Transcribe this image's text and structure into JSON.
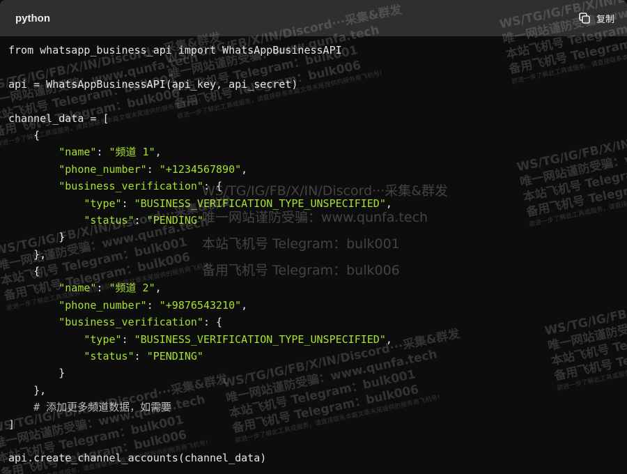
{
  "header": {
    "language": "python",
    "copy_label": "复制"
  },
  "code_lines": [
    [
      {
        "t": "from whatsapp_business_api import WhatsAppBusinessAPI",
        "c": "k"
      }
    ],
    [],
    [
      {
        "t": "api = WhatsAppBusinessAPI(api_key, api_secret)",
        "c": "k"
      }
    ],
    [],
    [
      {
        "t": "channel_data = [",
        "c": "k"
      }
    ],
    [
      {
        "t": "    {",
        "c": "k"
      }
    ],
    [
      {
        "t": "        ",
        "c": "k"
      },
      {
        "t": "\"name\"",
        "c": "s"
      },
      {
        "t": ": ",
        "c": "k"
      },
      {
        "t": "\"频道 1\"",
        "c": "s"
      },
      {
        "t": ",",
        "c": "k"
      }
    ],
    [
      {
        "t": "        ",
        "c": "k"
      },
      {
        "t": "\"phone_number\"",
        "c": "s"
      },
      {
        "t": ": ",
        "c": "k"
      },
      {
        "t": "\"+1234567890\"",
        "c": "s"
      },
      {
        "t": ",",
        "c": "k"
      }
    ],
    [
      {
        "t": "        ",
        "c": "k"
      },
      {
        "t": "\"business_verification\"",
        "c": "s"
      },
      {
        "t": ": {",
        "c": "k"
      }
    ],
    [
      {
        "t": "            ",
        "c": "k"
      },
      {
        "t": "\"type\"",
        "c": "s"
      },
      {
        "t": ": ",
        "c": "k"
      },
      {
        "t": "\"BUSINESS_VERIFICATION_TYPE_UNSPECIFIED\"",
        "c": "s"
      },
      {
        "t": ",",
        "c": "k"
      }
    ],
    [
      {
        "t": "            ",
        "c": "k"
      },
      {
        "t": "\"status\"",
        "c": "s"
      },
      {
        "t": ": ",
        "c": "k"
      },
      {
        "t": "\"PENDING\"",
        "c": "s"
      }
    ],
    [
      {
        "t": "        }",
        "c": "k"
      }
    ],
    [
      {
        "t": "    },",
        "c": "k"
      }
    ],
    [
      {
        "t": "    {",
        "c": "k"
      }
    ],
    [
      {
        "t": "        ",
        "c": "k"
      },
      {
        "t": "\"name\"",
        "c": "s"
      },
      {
        "t": ": ",
        "c": "k"
      },
      {
        "t": "\"频道 2\"",
        "c": "s"
      },
      {
        "t": ",",
        "c": "k"
      }
    ],
    [
      {
        "t": "        ",
        "c": "k"
      },
      {
        "t": "\"phone_number\"",
        "c": "s"
      },
      {
        "t": ": ",
        "c": "k"
      },
      {
        "t": "\"+9876543210\"",
        "c": "s"
      },
      {
        "t": ",",
        "c": "k"
      }
    ],
    [
      {
        "t": "        ",
        "c": "k"
      },
      {
        "t": "\"business_verification\"",
        "c": "s"
      },
      {
        "t": ": {",
        "c": "k"
      }
    ],
    [
      {
        "t": "            ",
        "c": "k"
      },
      {
        "t": "\"type\"",
        "c": "s"
      },
      {
        "t": ": ",
        "c": "k"
      },
      {
        "t": "\"BUSINESS_VERIFICATION_TYPE_UNSPECIFIED\"",
        "c": "s"
      },
      {
        "t": ",",
        "c": "k"
      }
    ],
    [
      {
        "t": "            ",
        "c": "k"
      },
      {
        "t": "\"status\"",
        "c": "s"
      },
      {
        "t": ": ",
        "c": "k"
      },
      {
        "t": "\"PENDING\"",
        "c": "s"
      }
    ],
    [
      {
        "t": "        }",
        "c": "k"
      }
    ],
    [
      {
        "t": "    },",
        "c": "k"
      }
    ],
    [
      {
        "t": "    # 添加更多频道数据，如需要",
        "c": "c"
      }
    ],
    [
      {
        "t": "]",
        "c": "k"
      }
    ],
    [],
    [
      {
        "t": "api.create_channel_accounts(channel_data)",
        "c": "k"
      }
    ]
  ],
  "watermark": {
    "lines": [
      "WS/TG/IG/FB/X/IN/Discord···采集&群发",
      "唯一网站谨防受骗：www.qunfa.tech",
      "本站飞机号 Telegram：bulk001",
      "备用飞机号 Telegram：bulk006"
    ],
    "footer": "欲进一步了解此工具或服务，请直接联系本篇文章末尾提供的服务商飞机号!"
  },
  "colors": {
    "background": "#0d0d0d",
    "header": "#2f2f2f",
    "string": "#a6e22e",
    "text": "#e6e6e6"
  }
}
